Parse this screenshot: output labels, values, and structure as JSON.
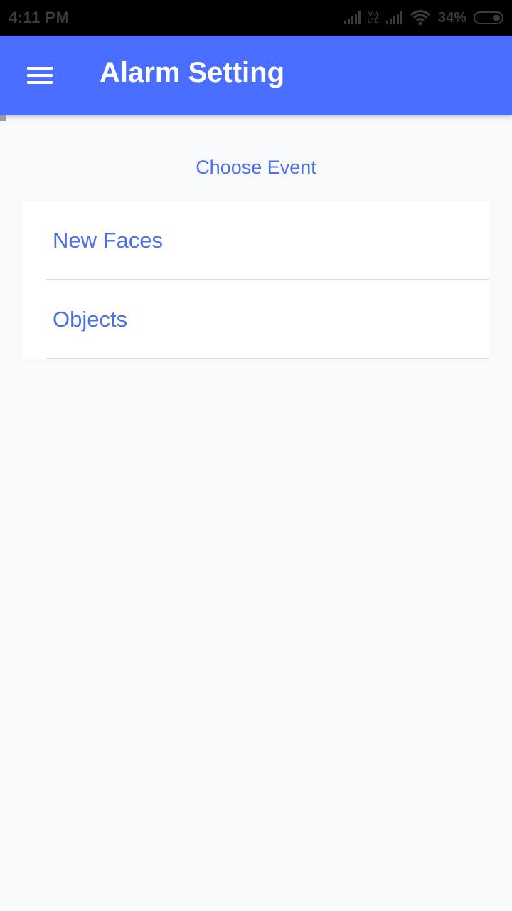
{
  "status_bar": {
    "time": "4:11 PM",
    "volte_top": "Vo)",
    "volte_bottom": "LTE",
    "battery_percent": "34%",
    "icons": [
      "signal-icon",
      "volte-icon",
      "signal-icon",
      "wifi-icon",
      "battery-icon"
    ]
  },
  "app_bar": {
    "menu_icon": "hamburger-menu-icon",
    "title": "Alarm Setting",
    "color": "#4a6eff"
  },
  "main": {
    "section_title": "Choose Event",
    "events": [
      {
        "label": "New Faces"
      },
      {
        "label": "Objects"
      }
    ],
    "accent_color": "#4a6fe8"
  }
}
